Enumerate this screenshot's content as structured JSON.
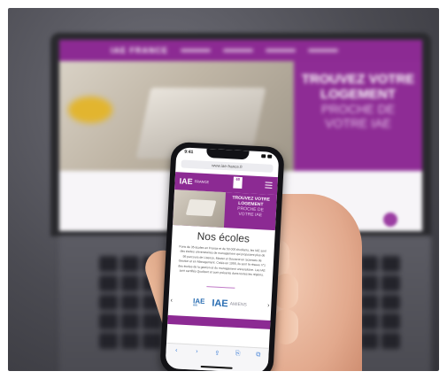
{
  "laptop": {
    "logo": "IAE FRANCE",
    "hero_line1": "TROUVEZ VOTRE",
    "hero_line2": "LOGEMENT",
    "hero_line3": "PROCHE DE",
    "hero_line4": "VOTRE IAE"
  },
  "phone": {
    "time": "9:41",
    "url": "www.iae-france.fr",
    "logo_main": "IAE",
    "logo_sub": "FRANCE",
    "badge": "60",
    "hero_line1": "TROUVEZ VOTRE",
    "hero_line2": "LOGEMENT",
    "hero_line3": "PROCHE DE",
    "hero_line4": "VOTRE IAE",
    "section_title": "Nos écoles",
    "section_text": "Forts de 35 écoles en France et de 50 000 étudiants, les IAE sont des écoles universitaires de management qui proposent plus de 98 parcours de Licence, Master et Doctorat en Sciences de Gestion et en Management. Créés en 1955, ils sont le réseau n°1 des écoles de la gestion et du management universitaire. Les IAE sont certifiés Qualicert et sont présents dans toutes les régions.",
    "school_a": "IAE",
    "school_a_sub": "AIX",
    "school_b": "IAE",
    "school_b_name": "AMIENS",
    "toolbar": [
      "‹",
      "›",
      "⇪",
      "⎘",
      "⧉"
    ]
  },
  "colors": {
    "brand_purple": "#8c2a93",
    "logo_blue": "#2c6fb3"
  }
}
